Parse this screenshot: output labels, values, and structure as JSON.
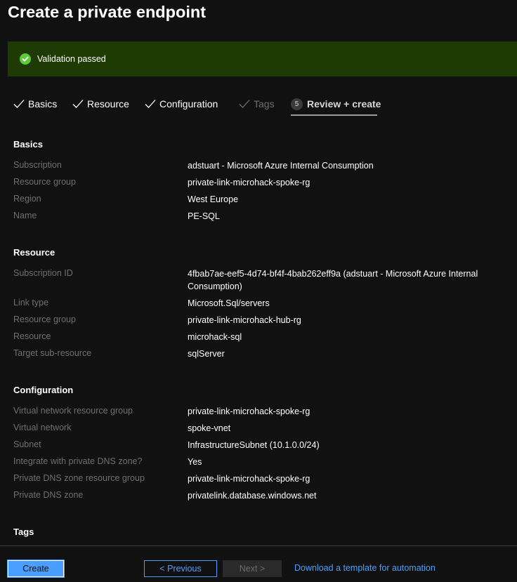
{
  "page": {
    "title": "Create a private endpoint"
  },
  "banner": {
    "text": "Validation passed",
    "color": "#1e3b05",
    "icon": "checkmark-circle-icon"
  },
  "steps": [
    {
      "label": "Basics",
      "state": "completed"
    },
    {
      "label": "Resource",
      "state": "completed"
    },
    {
      "label": "Configuration",
      "state": "completed"
    },
    {
      "label": "Tags",
      "state": "completed-disabled"
    },
    {
      "number": "5",
      "label": "Review + create",
      "state": "current"
    }
  ],
  "sections": {
    "basics": {
      "title": "Basics",
      "rows": [
        {
          "label": "Subscription",
          "value": "adstuart - Microsoft Azure Internal Consumption"
        },
        {
          "label": "Resource group",
          "value": "private-link-microhack-spoke-rg"
        },
        {
          "label": "Region",
          "value": "West Europe"
        },
        {
          "label": "Name",
          "value": "PE-SQL"
        }
      ]
    },
    "resource": {
      "title": "Resource",
      "rows": [
        {
          "label": "Subscription ID",
          "value": "4fbab7ae-eef5-4d74-bf4f-4bab262eff9a (adstuart - Microsoft Azure Internal Consumption)"
        },
        {
          "label": "Link type",
          "value": "Microsoft.Sql/servers"
        },
        {
          "label": "Resource group",
          "value": "private-link-microhack-hub-rg"
        },
        {
          "label": "Resource",
          "value": "microhack-sql"
        },
        {
          "label": "Target sub-resource",
          "value": "sqlServer"
        }
      ]
    },
    "configuration": {
      "title": "Configuration",
      "rows": [
        {
          "label": "Virtual network resource group",
          "value": "private-link-microhack-spoke-rg"
        },
        {
          "label": "Virtual network",
          "value": "spoke-vnet"
        },
        {
          "label": "Subnet",
          "value": "InfrastructureSubnet (10.1.0.0/24)"
        },
        {
          "label": "Integrate with private DNS zone?",
          "value": "Yes"
        },
        {
          "label": "Private DNS zone resource group",
          "value": "private-link-microhack-spoke-rg"
        },
        {
          "label": "Private DNS zone",
          "value": "privatelink.database.windows.net"
        }
      ]
    },
    "tags": {
      "title": "Tags"
    }
  },
  "footer": {
    "create_label": "Create",
    "previous_label": "< Previous",
    "next_label": "Next >",
    "download_link": "Download a template for automation"
  },
  "colors": {
    "accent": "#4a9eff",
    "success": "#5fc93a",
    "background": "#111111"
  }
}
